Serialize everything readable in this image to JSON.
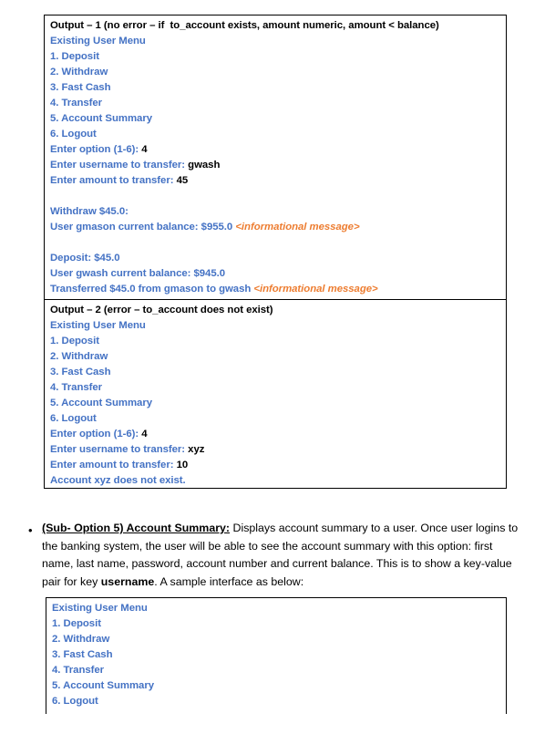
{
  "output_1": {
    "heading": "Output – 1 (no error – if  to_account exists, amount numeric, amount < balance)",
    "menu_title": "Existing User Menu",
    "menu_items": [
      "1. Deposit",
      "2. Withdraw",
      "3. Fast Cash",
      "4. Transfer",
      "5. Account Summary",
      "6. Logout"
    ],
    "prompts": [
      {
        "label": "Enter option (1-6): ",
        "value": "4"
      },
      {
        "label": "Enter username to transfer: ",
        "value": "gwash"
      },
      {
        "label": "Enter amount to transfer: ",
        "value": "45"
      }
    ],
    "result_block_1": [
      {
        "text": "Withdraw $45.0:",
        "note": ""
      },
      {
        "text": "User gmason current balance: $955.0 ",
        "note": "<informational message>"
      }
    ],
    "result_block_2": [
      {
        "text": "Deposit: $45.0",
        "note": ""
      },
      {
        "text": "User gwash current balance: $945.0",
        "note": ""
      },
      {
        "text": "Transferred $45.0 from gmason to gwash ",
        "note": "<informational message>"
      }
    ]
  },
  "output_2": {
    "heading": "Output – 2 (error – to_account does not exist)",
    "menu_title": "Existing User Menu",
    "menu_items": [
      "1. Deposit",
      "2. Withdraw",
      "3. Fast Cash",
      "4. Transfer",
      "5. Account Summary",
      "6. Logout"
    ],
    "prompts": [
      {
        "label": "Enter option (1-6): ",
        "value": "4"
      },
      {
        "label": "Enter username to transfer: ",
        "value": "xyz"
      },
      {
        "label": "Enter amount to transfer: ",
        "value": "10"
      }
    ],
    "error_line": "Account xyz does not exist."
  },
  "bullet": {
    "marker": "•",
    "heading": "(Sub- Option 5) Account Summary:",
    "body_part_1": " Displays account summary to a user. Once user logins to the banking system, the user will be able to see the account summary with this option: first name, last name, password, account number and current balance. This is to show a key-value pair for key ",
    "emphasis": "username",
    "body_part_2": ". A sample interface as below:"
  },
  "summary_box": {
    "menu_title": "Existing User Menu",
    "menu_items": [
      "1. Deposit",
      "2. Withdraw",
      "3. Fast Cash",
      "4. Transfer",
      "5. Account Summary",
      "6. Logout"
    ]
  },
  "colors": {
    "console_blue": "#4472C4",
    "note_orange": "#ED7D31",
    "border_black": "#000000",
    "text_black": "#000000"
  }
}
